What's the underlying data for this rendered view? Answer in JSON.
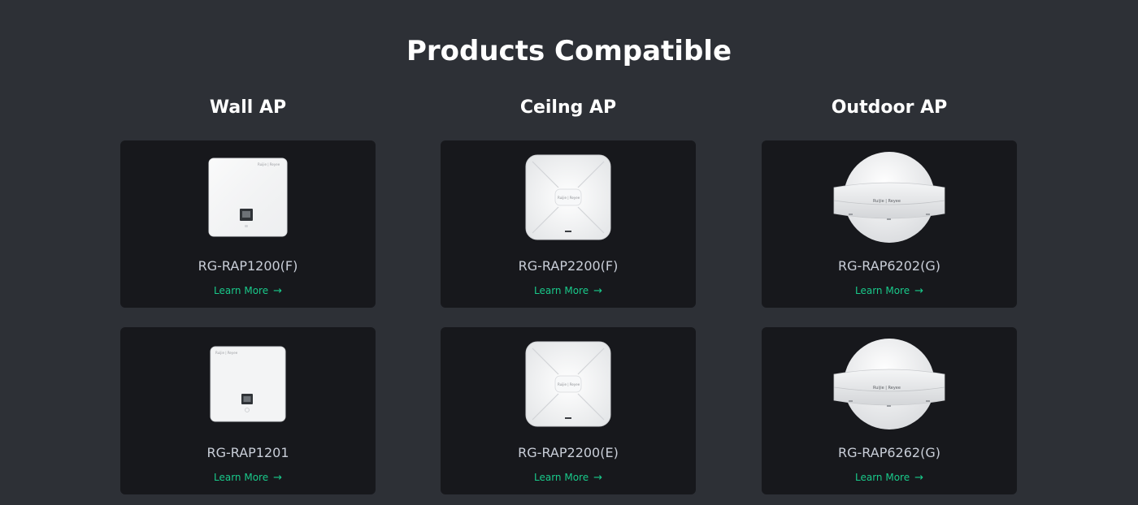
{
  "page": {
    "title": "Products Compatible"
  },
  "columns": [
    {
      "title": "Wall AP",
      "products": [
        {
          "name": "RG-RAP1200(F)",
          "link": "Learn More",
          "arrow": "→",
          "image": "wall-ap-image",
          "brand_mark": "Ruijie | Reyee"
        },
        {
          "name": "RG-RAP1201",
          "link": "Learn More",
          "arrow": "→",
          "image": "wall-ap-image",
          "brand_mark": "Ruijie | Reyee"
        }
      ]
    },
    {
      "title": "Ceilng AP",
      "products": [
        {
          "name": "RG-RAP2200(F)",
          "link": "Learn More",
          "arrow": "→",
          "image": "ceiling-ap-image",
          "brand_mark": "Ruijie | Reyee"
        },
        {
          "name": "RG-RAP2200(E)",
          "link": "Learn More",
          "arrow": "→",
          "image": "ceiling-ap-image",
          "brand_mark": "Ruijie | Reyee"
        }
      ]
    },
    {
      "title": "Outdoor AP",
      "products": [
        {
          "name": "RG-RAP6202(G)",
          "link": "Learn More",
          "arrow": "→",
          "image": "outdoor-ap-image",
          "brand_mark": "Ruijie | Reyee"
        },
        {
          "name": "RG-RAP6262(G)",
          "link": "Learn More",
          "arrow": "→",
          "image": "outdoor-ap-image",
          "brand_mark": "Ruijie | Reyee"
        }
      ]
    }
  ],
  "colors": {
    "background": "#2d3036",
    "card": "#17181c",
    "title": "#ffffff",
    "product_name": "#c9ced8",
    "link": "#19c98a"
  }
}
